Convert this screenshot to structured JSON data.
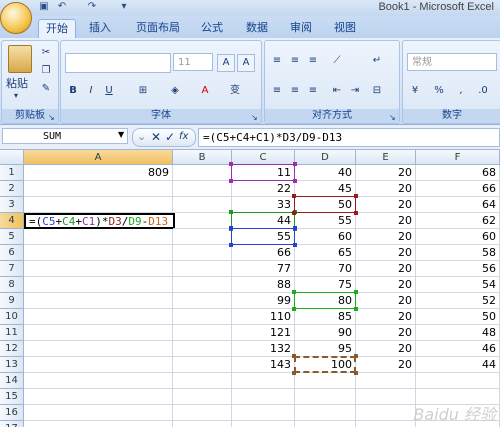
{
  "window": {
    "title": "Book1 - Microsoft Excel"
  },
  "tabs": [
    "开始",
    "插入",
    "页面布局",
    "公式",
    "数据",
    "审阅",
    "视图"
  ],
  "active_tab": "开始",
  "ribbon": {
    "paste_label": "粘贴",
    "font_size_value": "11",
    "number_format_value": "常规",
    "groups": {
      "clipboard": "剪贴板",
      "font": "字体",
      "alignment": "对齐方式",
      "number": "数字"
    }
  },
  "formula_bar": {
    "name_box": "SUM",
    "fx_label": "fx",
    "formula": "=(C5+C4+C1)*D3/D9-D13"
  },
  "columns": [
    "A",
    "B",
    "C",
    "D",
    "E",
    "F"
  ],
  "rows": [
    {
      "n": "1",
      "a": "809",
      "c": "11",
      "d": "40",
      "e": "20",
      "f": "68"
    },
    {
      "n": "2",
      "a": "",
      "c": "22",
      "d": "45",
      "e": "20",
      "f": "66"
    },
    {
      "n": "3",
      "a": "",
      "c": "33",
      "d": "50",
      "e": "20",
      "f": "64"
    },
    {
      "n": "4",
      "a": "",
      "c": "44",
      "d": "55",
      "e": "20",
      "f": "62"
    },
    {
      "n": "5",
      "a": "",
      "c": "55",
      "d": "60",
      "e": "20",
      "f": "60"
    },
    {
      "n": "6",
      "a": "",
      "c": "66",
      "d": "65",
      "e": "20",
      "f": "58"
    },
    {
      "n": "7",
      "a": "",
      "c": "77",
      "d": "70",
      "e": "20",
      "f": "56"
    },
    {
      "n": "8",
      "a": "",
      "c": "88",
      "d": "75",
      "e": "20",
      "f": "54"
    },
    {
      "n": "9",
      "a": "",
      "c": "99",
      "d": "80",
      "e": "20",
      "f": "52"
    },
    {
      "n": "10",
      "a": "",
      "c": "110",
      "d": "85",
      "e": "20",
      "f": "50"
    },
    {
      "n": "11",
      "a": "",
      "c": "121",
      "d": "90",
      "e": "20",
      "f": "48"
    },
    {
      "n": "12",
      "a": "",
      "c": "132",
      "d": "95",
      "e": "20",
      "f": "46"
    },
    {
      "n": "13",
      "a": "",
      "c": "143",
      "d": "100",
      "e": "20",
      "f": "44"
    },
    {
      "n": "14",
      "a": "",
      "c": "",
      "d": "",
      "e": "",
      "f": ""
    },
    {
      "n": "15",
      "a": "",
      "c": "",
      "d": "",
      "e": "",
      "f": ""
    },
    {
      "n": "16",
      "a": "",
      "c": "",
      "d": "",
      "e": "",
      "f": ""
    },
    {
      "n": "17",
      "a": "",
      "c": "",
      "d": "",
      "e": "",
      "f": ""
    }
  ],
  "editing_cell": {
    "ref": "A4",
    "parts": [
      {
        "text": "=(",
        "color": "#000000"
      },
      {
        "text": "C5",
        "color": "#2b3fd8"
      },
      {
        "text": "+",
        "color": "#000000"
      },
      {
        "text": "C4",
        "color": "#1f9a1f"
      },
      {
        "text": "+",
        "color": "#000000"
      },
      {
        "text": "C1",
        "color": "#9b2fb0"
      },
      {
        "text": ")*",
        "color": "#000000"
      },
      {
        "text": "D3",
        "color": "#9a1b1b"
      },
      {
        "text": "/",
        "color": "#000000"
      },
      {
        "text": "D9",
        "color": "#1faa1f"
      },
      {
        "text": "-",
        "color": "#000000"
      },
      {
        "text": "D13",
        "color": "#c4671c"
      }
    ]
  },
  "reference_colors": {
    "C1": "#9b2fb0",
    "C4": "#1f9a1f",
    "C5": "#2b3fd8",
    "D3": "#9a1b1b",
    "D9": "#1faa1f",
    "D13": "#8a5a2a"
  },
  "watermark": "Baidu 经验"
}
